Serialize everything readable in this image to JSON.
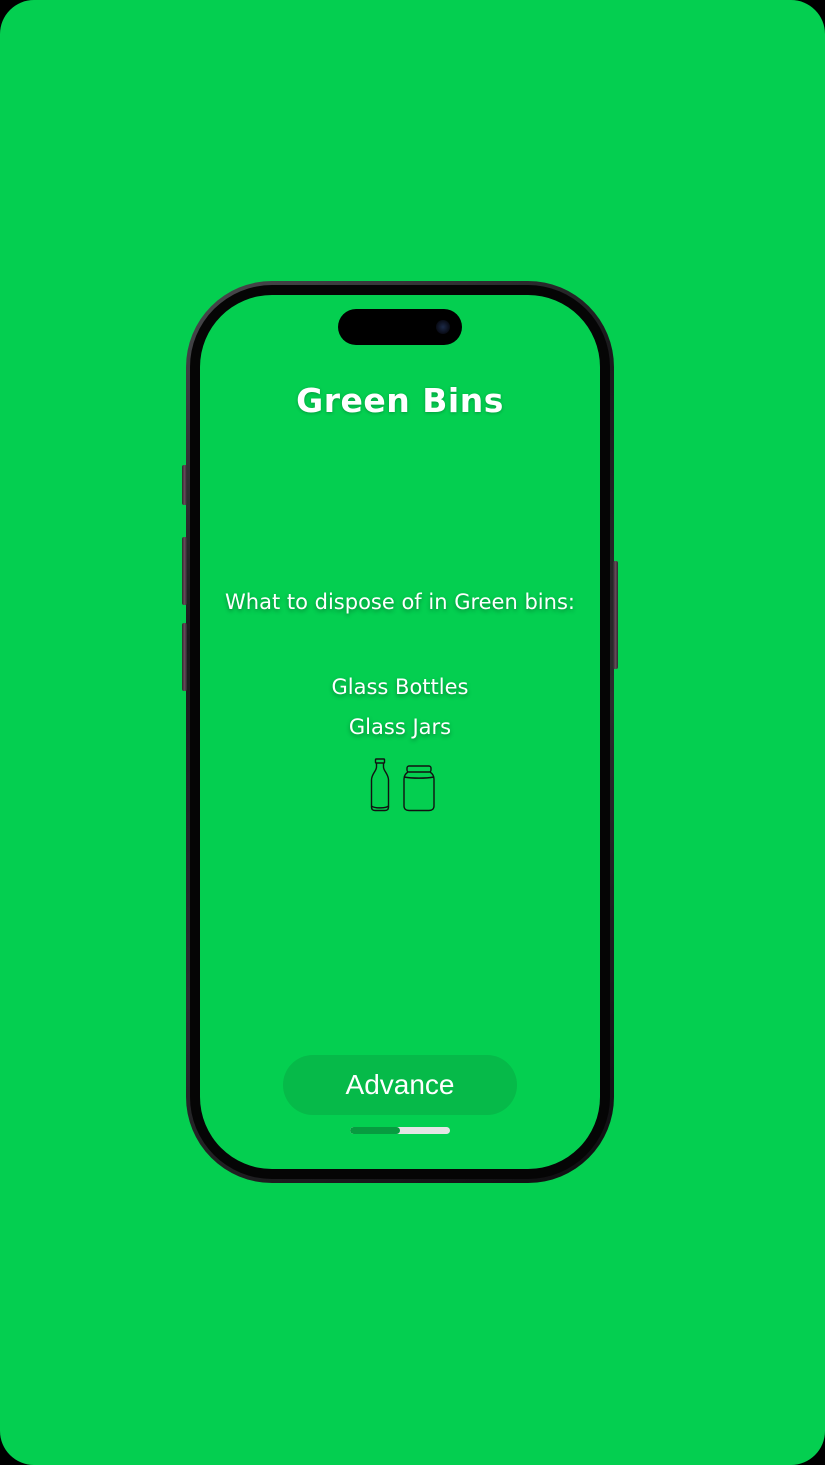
{
  "colors": {
    "background": "#04cf50",
    "button": "#06ba49",
    "text": "#ffffff",
    "progress_track": "#e5e5e5",
    "progress_fill": "#079c40"
  },
  "screen": {
    "title": "Green Bins",
    "subtitle": "What to dispose of in Green bins:",
    "items": [
      {
        "label": "Glass Bottles"
      },
      {
        "label": "Glass Jars"
      }
    ],
    "icons": [
      "glass-bottle-icon",
      "glass-jar-icon"
    ],
    "advance_label": "Advance",
    "progress_fraction": 0.5
  }
}
